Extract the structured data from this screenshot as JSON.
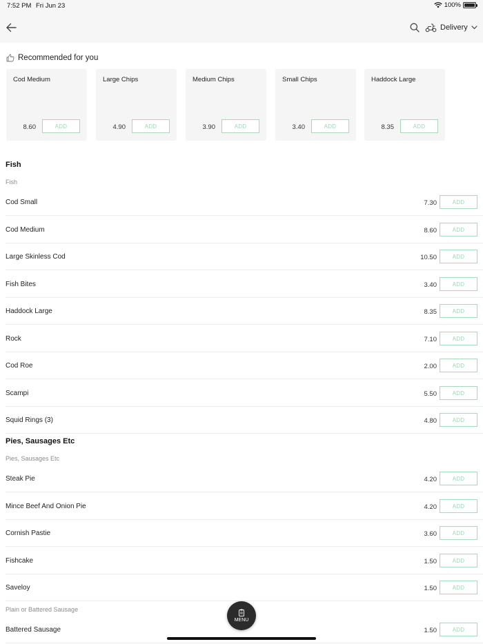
{
  "status_bar": {
    "time": "7:52 PM",
    "date": "Fri Jun 23",
    "battery": "100%"
  },
  "nav": {
    "delivery_label": "Delivery",
    "icons": [
      "back-arrow-icon",
      "search-icon",
      "scooter-icon",
      "chevron-down-icon"
    ]
  },
  "recommended": {
    "title": "Recommended for you",
    "items": [
      {
        "name": "Cod Medium",
        "price": "8.60",
        "add": "ADD"
      },
      {
        "name": "Large Chips",
        "price": "4.90",
        "add": "ADD"
      },
      {
        "name": "Medium Chips",
        "price": "3.90",
        "add": "ADD"
      },
      {
        "name": "Small Chips",
        "price": "3.40",
        "add": "ADD"
      },
      {
        "name": "Haddock Large",
        "price": "8.35",
        "add": "ADD"
      }
    ]
  },
  "sections": [
    {
      "title": "Fish",
      "subtitle": "Fish",
      "items": [
        {
          "name": "Cod Small",
          "price": "7.30",
          "add": "ADD"
        },
        {
          "name": "Cod Medium",
          "price": "8.60",
          "add": "ADD"
        },
        {
          "name": "Large Skinless Cod",
          "price": "10.50",
          "add": "ADD"
        },
        {
          "name": "Fish Bites",
          "price": "3.40",
          "add": "ADD"
        },
        {
          "name": "Haddock Large",
          "price": "8.35",
          "add": "ADD"
        },
        {
          "name": "Rock",
          "price": "7.10",
          "add": "ADD"
        },
        {
          "name": "Cod Roe",
          "price": "2.00",
          "add": "ADD"
        },
        {
          "name": "Scampi",
          "price": "5.50",
          "add": "ADD"
        },
        {
          "name": "Squid Rings (3)",
          "price": "4.80",
          "add": "ADD"
        }
      ]
    },
    {
      "title": "Pies, Sausages Etc",
      "subtitle": "Pies, Sausages Etc",
      "items": [
        {
          "name": "Steak Pie",
          "price": "4.20",
          "add": "ADD"
        },
        {
          "name": "Mince Beef And Onion Pie",
          "price": "4.20",
          "add": "ADD"
        },
        {
          "name": "Cornish Pastie",
          "price": "3.60",
          "add": "ADD"
        },
        {
          "name": "Fishcake",
          "price": "1.50",
          "add": "ADD"
        },
        {
          "name": "Saveloy",
          "price": "1.50",
          "add": "ADD"
        }
      ],
      "group2_subtitle": "Plain or Battered Sausage",
      "group2_items": [
        {
          "name": "Battered Sausage",
          "price": "1.50",
          "add": "ADD"
        }
      ]
    }
  ],
  "menu_button": {
    "label": "MENU"
  }
}
